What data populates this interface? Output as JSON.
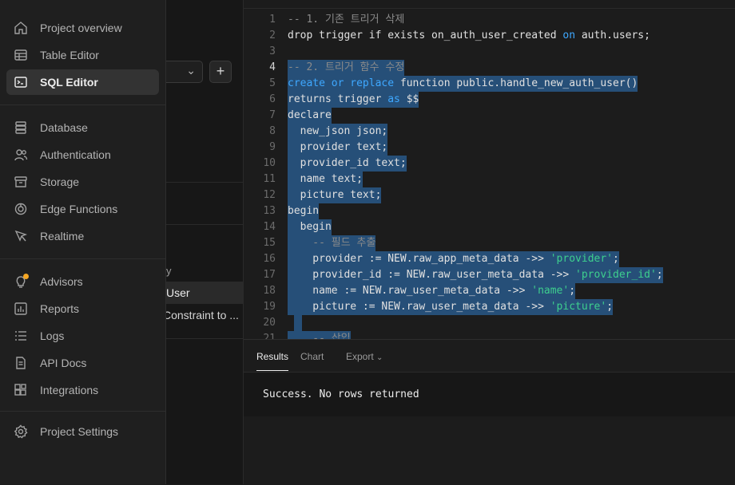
{
  "sidebar": {
    "items": [
      {
        "label": "Project overview",
        "icon": "home-icon"
      },
      {
        "label": "Table Editor",
        "icon": "table-icon"
      },
      {
        "label": "SQL Editor",
        "icon": "terminal-icon"
      },
      {
        "label": "Database",
        "icon": "database-icon"
      },
      {
        "label": "Authentication",
        "icon": "users-icon"
      },
      {
        "label": "Storage",
        "icon": "archive-icon"
      },
      {
        "label": "Edge Functions",
        "icon": "functions-icon"
      },
      {
        "label": "Realtime",
        "icon": "realtime-icon"
      },
      {
        "label": "Advisors",
        "icon": "lightbulb-icon"
      },
      {
        "label": "Reports",
        "icon": "chart-icon"
      },
      {
        "label": "Logs",
        "icon": "list-icon"
      },
      {
        "label": "API Docs",
        "icon": "document-icon"
      },
      {
        "label": "Integrations",
        "icon": "blocks-icon"
      },
      {
        "label": "Project Settings",
        "icon": "gear-icon"
      }
    ],
    "active": "SQL Editor"
  },
  "snippets": {
    "add_label": "+",
    "chevron": "⌄",
    "fragment": "y",
    "item_user": "User",
    "item_constraint": "Constraint to ..."
  },
  "editor": {
    "lines": [
      {
        "n": "1",
        "text": "-- 1. 기존 트리거 삭제"
      },
      {
        "n": "2",
        "text": "drop trigger if exists on_auth_user_created on auth.users;"
      },
      {
        "n": "3",
        "text": ""
      },
      {
        "n": "4",
        "text": "-- 2. 트리거 함수 수정"
      },
      {
        "n": "5",
        "text": "create or replace function public.handle_new_auth_user()"
      },
      {
        "n": "6",
        "text": "returns trigger as $$"
      },
      {
        "n": "7",
        "text": "declare"
      },
      {
        "n": "8",
        "text": "  new_json json;"
      },
      {
        "n": "9",
        "text": "  provider text;"
      },
      {
        "n": "10",
        "text": "  provider_id text;"
      },
      {
        "n": "11",
        "text": "  name text;"
      },
      {
        "n": "12",
        "text": "  picture text;"
      },
      {
        "n": "13",
        "text": "begin"
      },
      {
        "n": "14",
        "text": "  begin"
      },
      {
        "n": "15",
        "text": "    -- 필드 추출"
      },
      {
        "n": "16",
        "text": "    provider := NEW.raw_app_meta_data ->> 'provider';"
      },
      {
        "n": "17",
        "text": "    provider_id := NEW.raw_user_meta_data ->> 'provider_id';"
      },
      {
        "n": "18",
        "text": "    name := NEW.raw_user_meta_data ->> 'name';"
      },
      {
        "n": "19",
        "text": "    picture := NEW.raw_user_meta_data ->> 'picture';"
      },
      {
        "n": "20",
        "text": ""
      },
      {
        "n": "21",
        "text": "    -- 삽입"
      }
    ]
  },
  "results": {
    "tabs": [
      "Results",
      "Chart",
      "Export"
    ],
    "message": "Success. No rows returned"
  },
  "colors": {
    "selection": "#264f78",
    "keyword": "#3ea8ff",
    "string": "#3ecf8e",
    "advisor_dot": "#f5a623"
  }
}
